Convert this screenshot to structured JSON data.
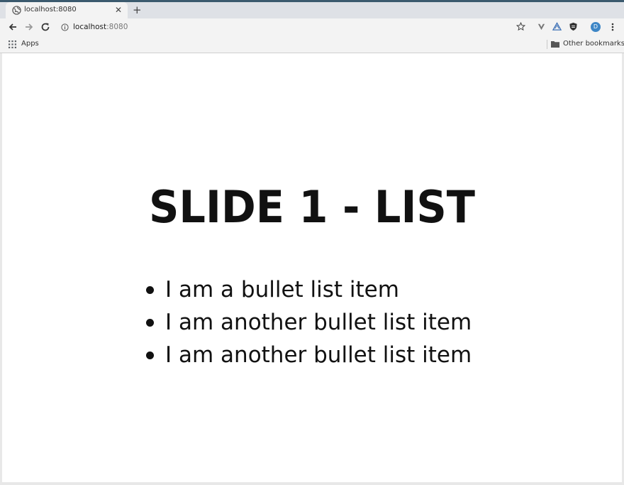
{
  "browser": {
    "tab": {
      "title": "localhost:8080",
      "close_glyph": "✕"
    },
    "new_tab_glyph": "+",
    "omnibox": {
      "host": "localhost",
      "port": ":8080"
    },
    "profile_initial": "D",
    "bookmarks": {
      "apps_label": "Apps",
      "other_label": "Other bookmarks"
    },
    "icons": [
      "globe-icon",
      "back-icon",
      "forward-icon",
      "reload-icon",
      "info-icon",
      "star-icon",
      "extension-icon",
      "menu-icon",
      "apps-grid-icon",
      "folder-icon"
    ]
  },
  "slide": {
    "title": "SLIDE 1 - LIST",
    "items": [
      "I am a bullet list item",
      "I am another bullet list item",
      "I am another bullet list item"
    ]
  }
}
